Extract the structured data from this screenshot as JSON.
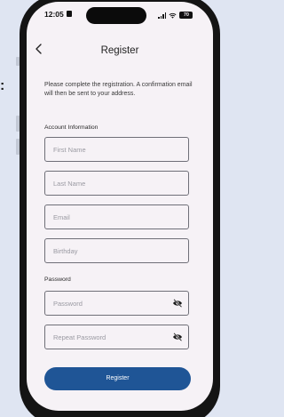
{
  "side_glyph": ":",
  "status_bar": {
    "time": "12:05",
    "battery": "70"
  },
  "nav": {
    "title": "Register"
  },
  "intro_text": "Please complete the registration. A confirmation email will then be sent to your address.",
  "account_section": {
    "label": "Account Information",
    "first_name_placeholder": "First Name",
    "last_name_placeholder": "Last Name",
    "email_placeholder": "Email",
    "birthday_placeholder": "Birthday"
  },
  "password_section": {
    "label": "Password",
    "password_placeholder": "Password",
    "repeat_password_placeholder": "Repeat Password",
    "visibility_icon": "eye-off-icon"
  },
  "actions": {
    "register_label": "Register"
  },
  "colors": {
    "primary_button": "#1f5596",
    "screen_background": "#f6f2f6",
    "field_border": "#6f6f78"
  }
}
